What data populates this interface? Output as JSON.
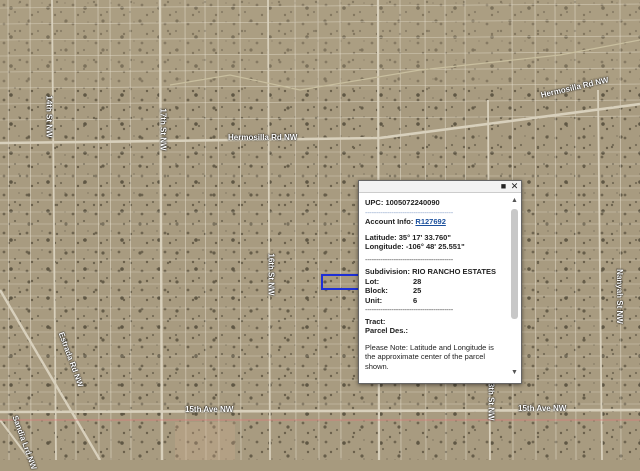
{
  "map": {
    "colors": {
      "ground": "#a79a7e",
      "road": "#d8d0bc",
      "parcel_line": "#e4ddcc",
      "selection": "#1d2fd6",
      "county_line": "#e07878"
    },
    "road_labels": [
      {
        "text": "Hermosilla Rd NW"
      },
      {
        "text": "Hermosilla Rd NW"
      },
      {
        "text": "14th St NW"
      },
      {
        "text": "17th St NW"
      },
      {
        "text": "16th St NW"
      },
      {
        "text": "Estrada Rd NW"
      },
      {
        "text": "15th Ave NW"
      },
      {
        "text": "15th Ave NW"
      },
      {
        "text": "13th St NW"
      },
      {
        "text": "Nanyah St NW"
      },
      {
        "text": "Sandia Lrd NW"
      }
    ]
  },
  "popup": {
    "upc_label": "UPC:",
    "upc_value": "1005072240090",
    "account_label": "Account Info:",
    "account_value": "R127692",
    "latitude_label": "Latitude:",
    "latitude_value": "35° 17' 33.760\"",
    "longitude_label": "Longitude:",
    "longitude_value": "-106° 48' 25.551\"",
    "separator": "----------------------------------------",
    "subdivision_label": "Subdivision:",
    "subdivision_value": "RIO RANCHO ESTATES",
    "lot_label": "Lot:",
    "lot_value": "28",
    "block_label": "Block:",
    "block_value": "25",
    "unit_label": "Unit:",
    "unit_value": "6",
    "tract_label": "Tract:",
    "parcel_label": "Parcel Des.:",
    "note": "Please Note: Latitude and Longitude is the approximate center of the parcel shown.",
    "icons": [
      "maximize-icon",
      "close-icon",
      "scroll-up-icon",
      "scroll-down-icon"
    ]
  }
}
